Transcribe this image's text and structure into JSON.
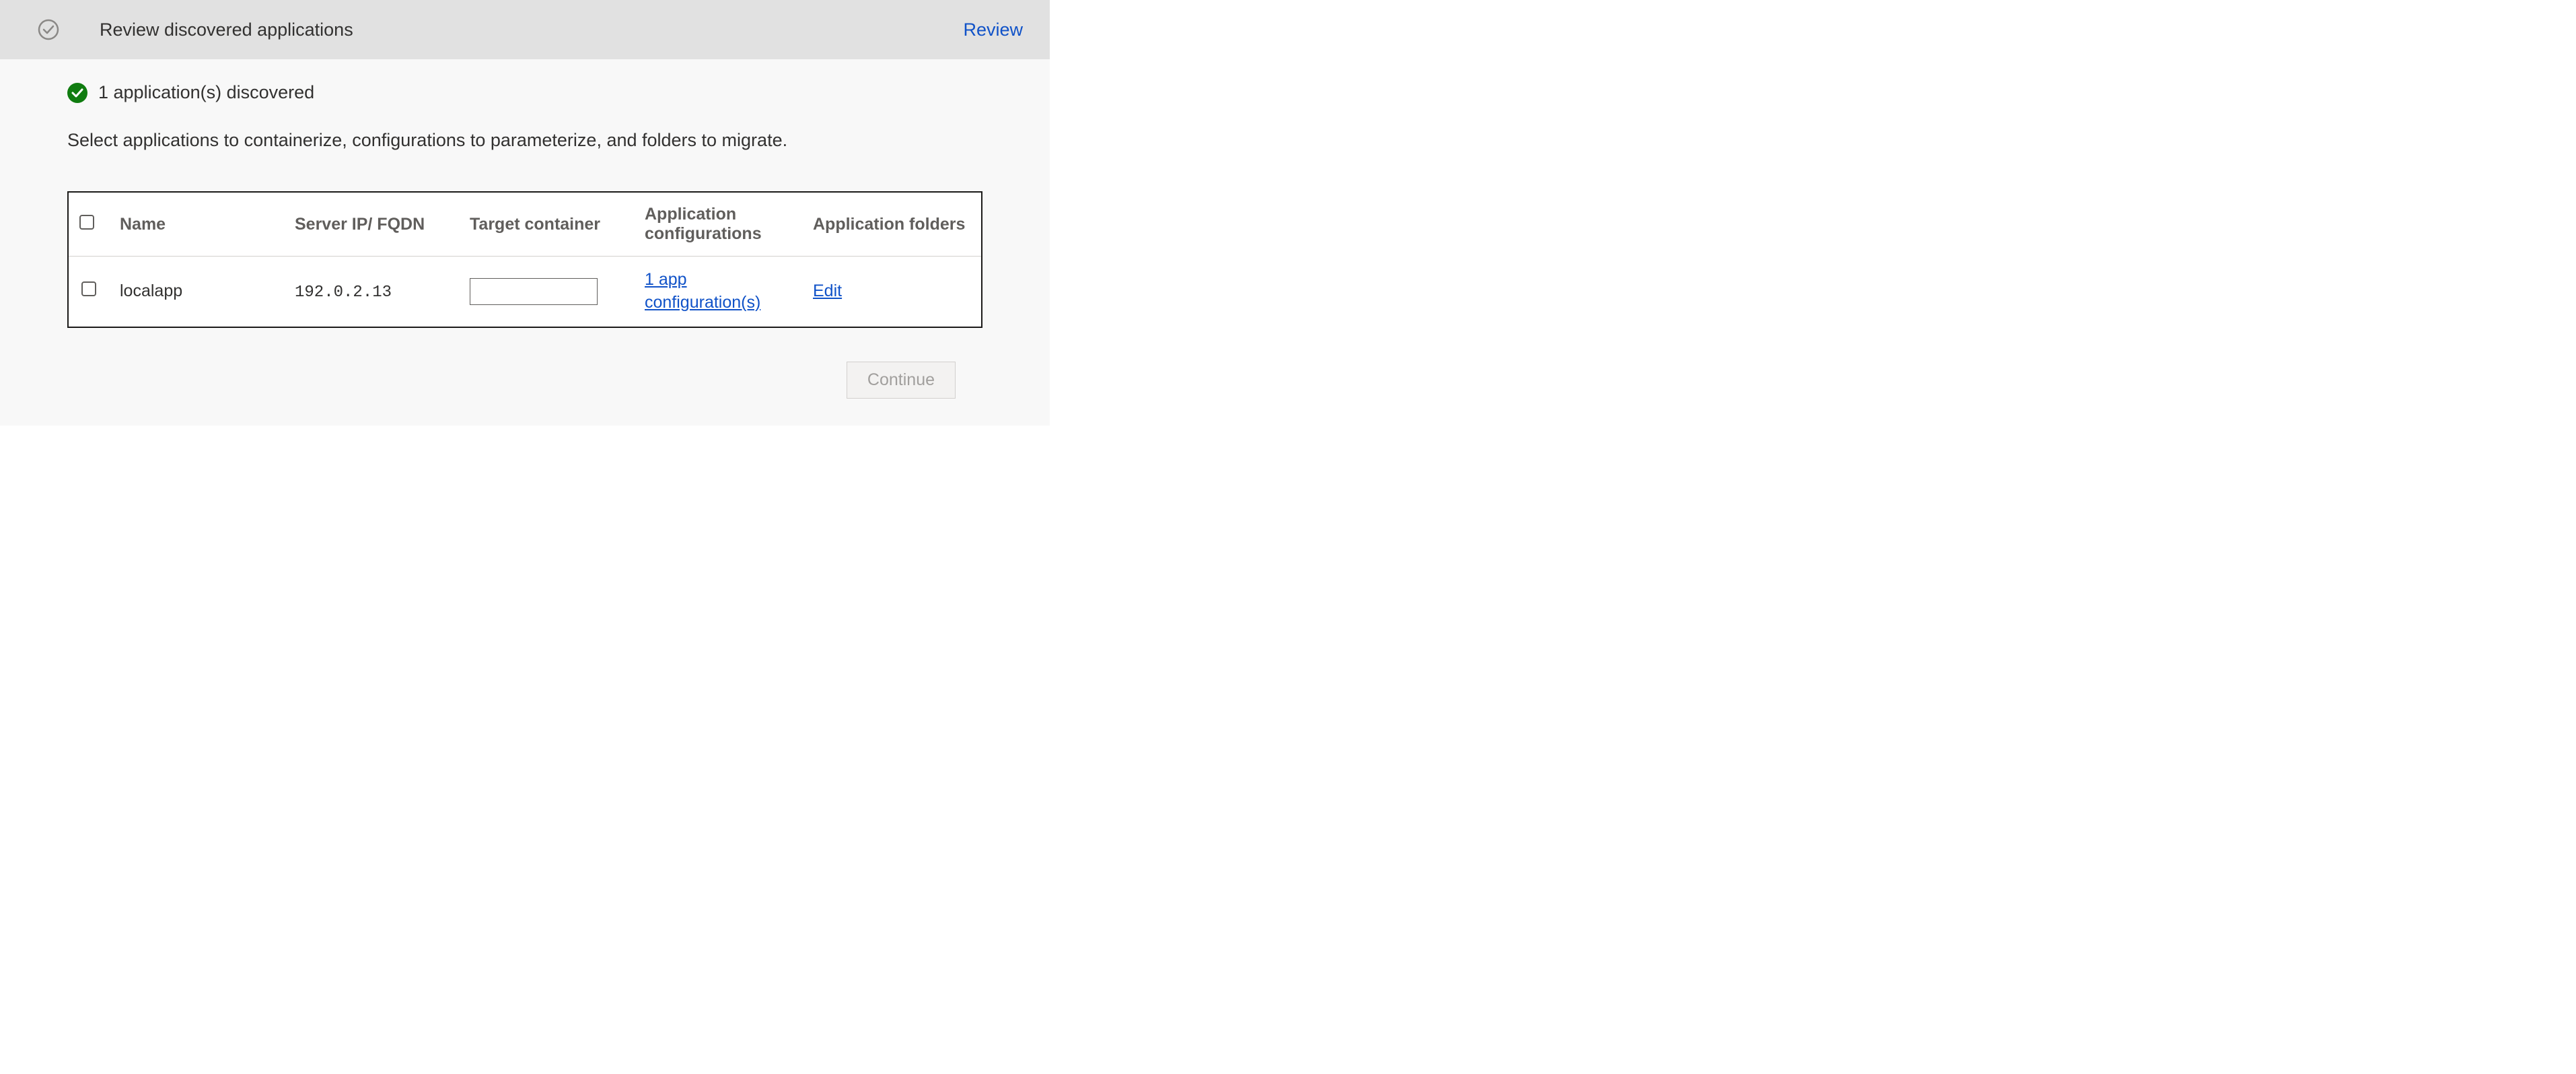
{
  "header": {
    "title": "Review discovered applications",
    "review_link": "Review"
  },
  "status": {
    "message": "1 application(s) discovered"
  },
  "instruction": "Select applications to containerize, configurations to parameterize, and folders to migrate.",
  "table": {
    "columns": {
      "name": "Name",
      "server": "Server IP/ FQDN",
      "target": "Target container",
      "configs": "Application configurations",
      "folders": "Application folders"
    },
    "rows": [
      {
        "name": "localapp",
        "server": "192.0.2.13",
        "target": "",
        "config_link": "1 app configuration(s)",
        "folders_link": "Edit"
      }
    ]
  },
  "footer": {
    "continue_label": "Continue"
  }
}
